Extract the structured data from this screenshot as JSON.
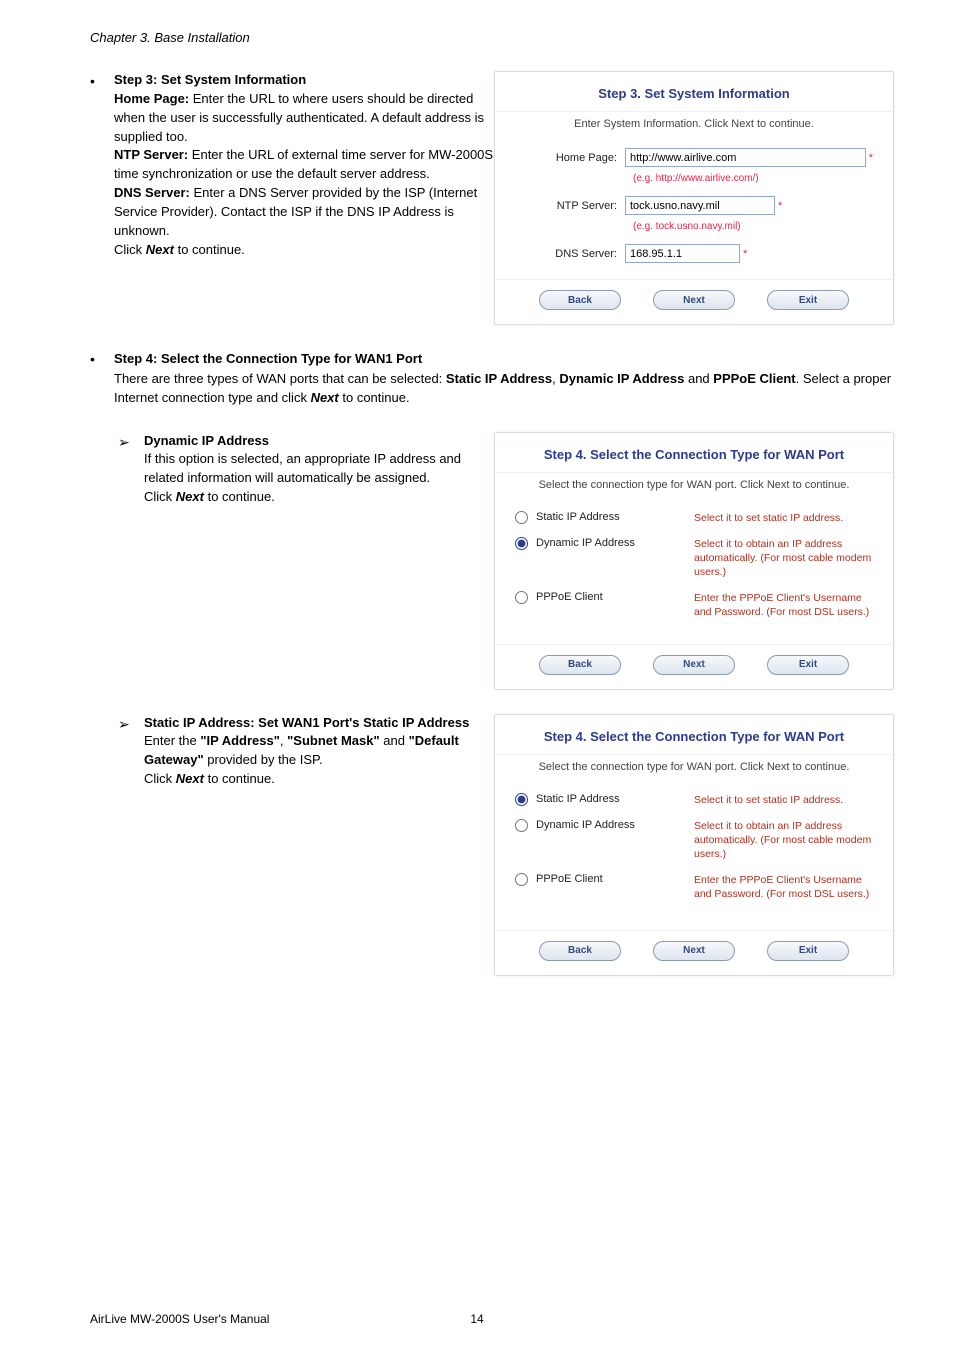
{
  "chapter": "Chapter 3.    Base Installation",
  "step3": {
    "title": "Step 3: Set System Information",
    "body_l1": "Home Page:",
    "body_t1": " Enter the URL to where users should be directed when the user is successfully authenticated. A default address is supplied too.",
    "body_l2": "NTP Server:",
    "body_t2": " Enter the URL of external time server for MW-2000S time synchronization or use the default server address.",
    "body_l3": "DNS Server:",
    "body_t3": " Enter a DNS Server provided by the ISP (Internet Service Provider). Contact the ISP if the DNS IP Address is unknown.",
    "click_next": "Click ",
    "next_word": "Next",
    "to_continue": " to continue."
  },
  "panel3": {
    "title": "Step 3. Set System Information",
    "subtitle": "Enter System Information. Click Next to continue.",
    "home_label": "Home Page:",
    "home_value": "http://www.airlive.com",
    "home_eg": "(e.g. http://www.airlive.com/)",
    "ntp_label": "NTP Server:",
    "ntp_value": "tock.usno.navy.mil",
    "ntp_eg": "(e.g. tock.usno.navy.mil)",
    "dns_label": "DNS Server:",
    "dns_value": "168.95.1.1",
    "btn_back": "Back",
    "btn_next": "Next",
    "btn_exit": "Exit"
  },
  "step4": {
    "title": "Step 4: Select the Connection Type for WAN1 Port",
    "body1": "There are three types of WAN ports that can be selected: ",
    "b1": "Static IP Address",
    "comma": ", ",
    "b2": "Dynamic IP Address",
    "and": " and ",
    "b3": "PPPoE Client",
    "body2": ". Select a proper Internet connection type and click ",
    "next_word": "Next",
    "body3": " to continue."
  },
  "dyn": {
    "title": "Dynamic IP Address",
    "body": "If this option is selected, an appropriate IP address and related information will automatically be assigned.",
    "click_next": "Click ",
    "next_word": "Next",
    "to_continue": " to continue."
  },
  "panel4": {
    "title": "Step 4. Select the Connection Type for WAN Port",
    "subtitle": "Select the connection type for WAN port. Click Next to continue.",
    "opt1": "Static IP Address",
    "opt1_desc": "Select it to set static IP address.",
    "opt2": "Dynamic IP Address",
    "opt2_desc": "Select it to obtain an IP address automatically. (For most cable modem users.)",
    "opt3": "PPPoE Client",
    "opt3_desc": "Enter the PPPoE Client's Username and Password. (For most DSL users.)",
    "btn_back": "Back",
    "btn_next": "Next",
    "btn_exit": "Exit"
  },
  "stat": {
    "title": "Static IP Address: Set WAN1 Port's Static IP Address",
    "body1": "Enter the ",
    "q1": "\"IP Address\"",
    "comma": ", ",
    "q2": "\"Subnet Mask\"",
    "and": " and ",
    "q3": "\"Default Gateway\"",
    "body2": " provided by the ISP.",
    "click_next": "Click ",
    "next_word": "Next",
    "to_continue": " to continue."
  },
  "footer_left": "AirLive MW-2000S User's Manual",
  "footer_center": "14"
}
